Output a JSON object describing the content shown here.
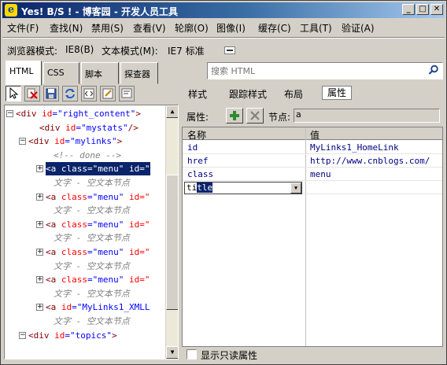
{
  "window": {
    "title": "Yes! B/S ! - 博客园 - 开发人员工具"
  },
  "menu": [
    "文件(F)",
    "查找(N)",
    "禁用(S)",
    "查看(V)",
    "轮廓(O)",
    "图像(I)",
    "缓存(C)",
    "工具(T)",
    "验证(A)"
  ],
  "mode": {
    "browser_label": "浏览器模式:",
    "browser_value": "IE8(B)",
    "doc_label": "文本模式(M):",
    "doc_value": "IE7 标准"
  },
  "tabs": [
    "HTML",
    "CSS",
    "脚本",
    "探查器"
  ],
  "search": {
    "placeholder": "搜索 HTML"
  },
  "subtabs": [
    "样式",
    "跟踪样式",
    "布局",
    "属性"
  ],
  "tree": [
    {
      "kind": "element",
      "tag": "div",
      "attr": "id",
      "val": "\"right_content\"",
      "close": ">"
    },
    {
      "kind": "element",
      "tag": "div",
      "attr": "id",
      "val": "\"mystats\"",
      "close": "/>"
    },
    {
      "kind": "element",
      "tag": "div",
      "attr": "id",
      "val": "\"mylinks\"",
      "close": ">"
    },
    {
      "kind": "comment",
      "text": "<!-- done -->"
    },
    {
      "kind": "element",
      "tag": "a",
      "attr": "class",
      "val": "\"menu\"",
      "extra": "id=\"",
      "close": ""
    },
    {
      "kind": "text",
      "text": "文字 - 空文本节点"
    },
    {
      "kind": "element",
      "tag": "a",
      "attr": "class",
      "val": "\"menu\"",
      "extra": "id=\"",
      "close": ""
    },
    {
      "kind": "text",
      "text": "文字 - 空文本节点"
    },
    {
      "kind": "element",
      "tag": "a",
      "attr": "class",
      "val": "\"menu\"",
      "extra": "id=\"",
      "close": ""
    },
    {
      "kind": "text",
      "text": "文字 - 空文本节点"
    },
    {
      "kind": "element",
      "tag": "a",
      "attr": "class",
      "val": "\"menu\"",
      "extra": "id=\"",
      "close": ""
    },
    {
      "kind": "text",
      "text": "文字 - 空文本节点"
    },
    {
      "kind": "element",
      "tag": "a",
      "attr": "class",
      "val": "\"menu\"",
      "extra": "id=\"",
      "close": ""
    },
    {
      "kind": "text",
      "text": "文字 - 空文本节点"
    },
    {
      "kind": "element",
      "tag": "a",
      "attr": "id",
      "val": "\"MyLinks1_XMLL",
      "close": ""
    },
    {
      "kind": "text",
      "text": "文字 - 空文本节点"
    },
    {
      "kind": "element",
      "tag": "div",
      "attr": "id",
      "val": "\"topics\"",
      "close": ">"
    }
  ],
  "attrs": {
    "label": "属性:",
    "node_label": "节点:",
    "node_value": "a",
    "col_name": "名称",
    "col_value": "值",
    "rows": [
      {
        "name": "id",
        "value": "MyLinks1_HomeLink"
      },
      {
        "name": "href",
        "value": "http://www.cnblogs.com/"
      },
      {
        "name": "class",
        "value": "menu"
      }
    ],
    "edit_prefix": "ti",
    "edit_selected": "tle"
  },
  "readonly_label": "显示只读属性"
}
